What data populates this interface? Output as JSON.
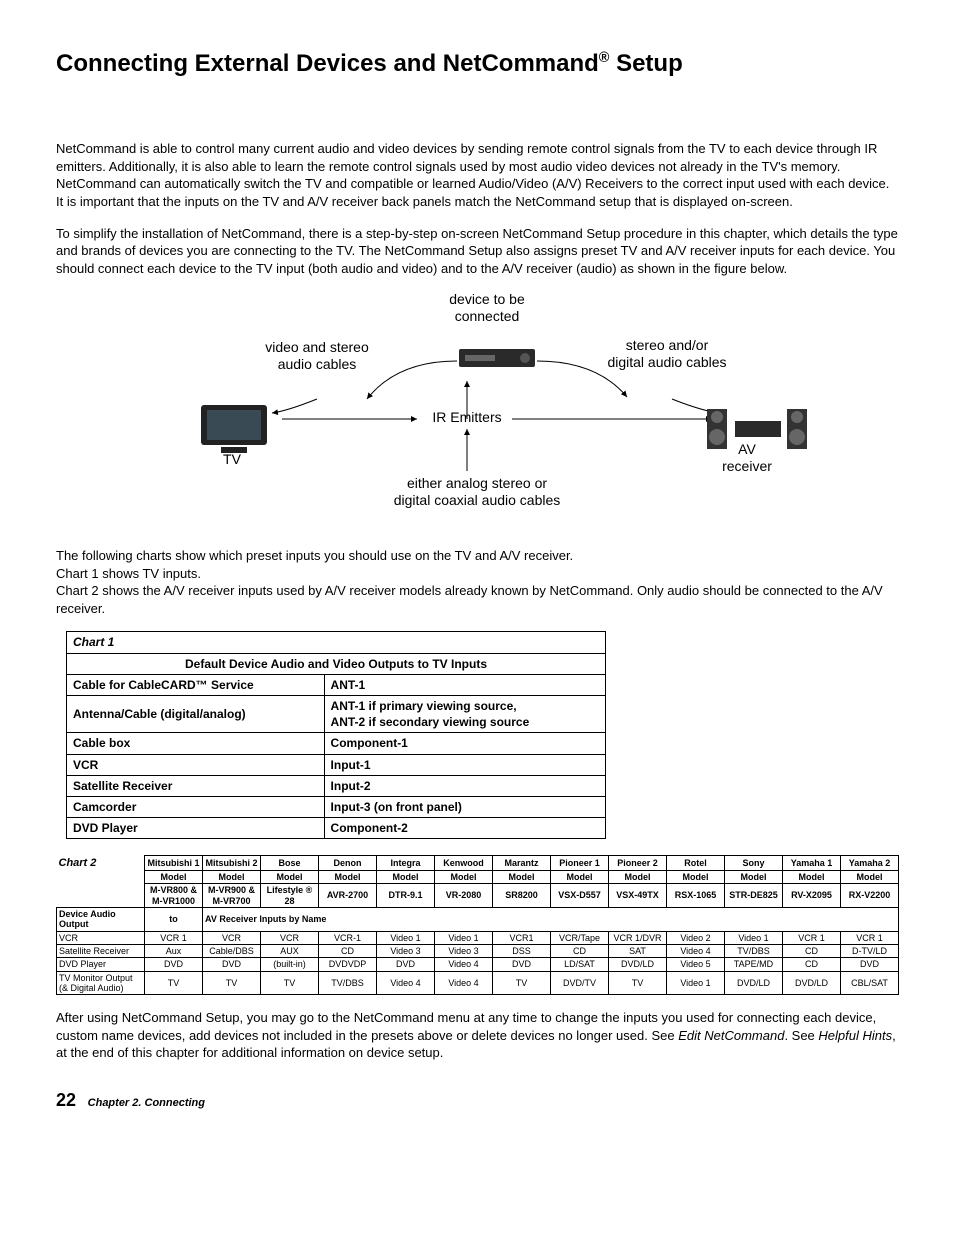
{
  "title_a": "Connecting External Devices and NetCommand",
  "title_b": " Setup",
  "para1": "NetCommand is able to control many current audio and video devices by sending remote control signals from the TV to each device through IR emitters.  Additionally, it is also able to learn the remote control signals used by most audio video devices not already in the TV's memory.  NetCommand can automatically switch the TV and compatible or learned Audio/Video (A/V) Receivers to the correct input used with each device.  It is important that the inputs on the TV and A/V receiver back panels match the NetCommand setup that is displayed on-screen.",
  "para2": "To simplify the installation of NetCommand, there is a step-by-step on-screen NetCommand Setup procedure in this chapter, which details the type and brands of devices you are connecting to the TV.  The NetCommand Setup also assigns preset TV and A/V receiver inputs for each device.  You should connect each device to the TV input (both audio and video) and to the A/V receiver (audio) as shown in the figure below.",
  "diagram": {
    "device_to_be": "device to be\nconnected",
    "video_stereo": "video and stereo\naudio cables",
    "stereo_digital": "stereo and/or\ndigital audio cables",
    "ir": "IR Emitters",
    "tv": "TV",
    "av": "AV\nreceiver",
    "either": "either analog stereo or\ndigital coaxial audio cables"
  },
  "charts_intro_1": "The following charts show which preset inputs you should use on the TV and A/V receiver.",
  "charts_intro_2": "Chart 1 shows TV inputs.",
  "charts_intro_3": "Chart 2 shows the A/V receiver inputs used by A/V receiver models already known by NetCommand.  Only audio should be connected to the A/V receiver.",
  "chart1": {
    "title": "Chart 1",
    "subtitle": "Default Device Audio and Video Outputs to TV Inputs",
    "rows": [
      [
        "Cable for CableCARD™ Service",
        "ANT-1"
      ],
      [
        "Antenna/Cable (digital/analog)",
        "ANT-1 if primary viewing source,\nANT-2 if secondary viewing source"
      ],
      [
        "Cable box",
        "Component-1"
      ],
      [
        "VCR",
        "Input-1"
      ],
      [
        "Satellite Receiver",
        "Input-2"
      ],
      [
        "Camcorder",
        "Input-3 (on front panel)"
      ],
      [
        "DVD Player",
        "Component-2"
      ]
    ]
  },
  "chart2": {
    "title": "Chart 2",
    "headers": [
      "Mitsubishi 1",
      "Mitsubishi 2",
      "Bose",
      "Denon",
      "Integra",
      "Kenwood",
      "Marantz",
      "Pioneer 1",
      "Pioneer 2",
      "Rotel",
      "Sony",
      "Yamaha 1",
      "Yamaha 2"
    ],
    "models_label": "Model",
    "models": [
      "M-VR800 &\nM-VR1000",
      "M-VR900 &\nM-VR700",
      "Lifestyle ® 28",
      "AVR-2700",
      "DTR-9.1",
      "VR-2080",
      "SR8200",
      "VSX-D557",
      "VSX-49TX",
      "RSX-1065",
      "STR-DE825",
      "RV-X2095",
      "RX-V2200"
    ],
    "dao_label": "Device Audio Output",
    "to_label": "to",
    "avri_label": "AV Receiver Inputs by Name",
    "rows": [
      {
        "label": "VCR",
        "cells": [
          "VCR 1",
          "VCR",
          "VCR",
          "VCR-1",
          "Video 1",
          "Video 1",
          "VCR1",
          "VCR/Tape",
          "VCR 1/DVR",
          "Video 2",
          "Video 1",
          "VCR 1",
          "VCR 1"
        ]
      },
      {
        "label": "Satellite Receiver",
        "cells": [
          "Aux",
          "Cable/DBS",
          "AUX",
          "CD",
          "Video 3",
          "Video 3",
          "DSS",
          "CD",
          "SAT",
          "Video 4",
          "TV/DBS",
          "CD",
          "D-TV/LD"
        ]
      },
      {
        "label": "DVD Player",
        "cells": [
          "DVD",
          "DVD",
          "(built-in)",
          "DVDVDP",
          "DVD",
          "Video 4",
          "DVD",
          "LD/SAT",
          "DVD/LD",
          "Video 5",
          "TAPE/MD",
          "CD",
          "DVD"
        ]
      },
      {
        "label": "TV Monitor Output\n(& Digital Audio)",
        "cells": [
          "TV",
          "TV",
          "TV",
          "TV/DBS",
          "Video 4",
          "Video 4",
          "TV",
          "DVD/TV",
          "TV",
          "Video 1",
          "DVD/LD",
          "DVD/LD",
          "CBL/SAT"
        ]
      }
    ]
  },
  "para3_a": "After using NetCommand Setup, you may go to the NetCommand menu at any time to change the inputs you used for connecting each device, custom name devices, add devices not included in the presets above or delete devices no longer used.  See ",
  "para3_b": "Edit NetCommand",
  "para3_c": ".  See ",
  "para3_d": "Helpful Hints",
  "para3_e": ", at the end of this chapter for additional information on device setup.",
  "page_num": "22",
  "chapter": "Chapter 2.  Connecting"
}
